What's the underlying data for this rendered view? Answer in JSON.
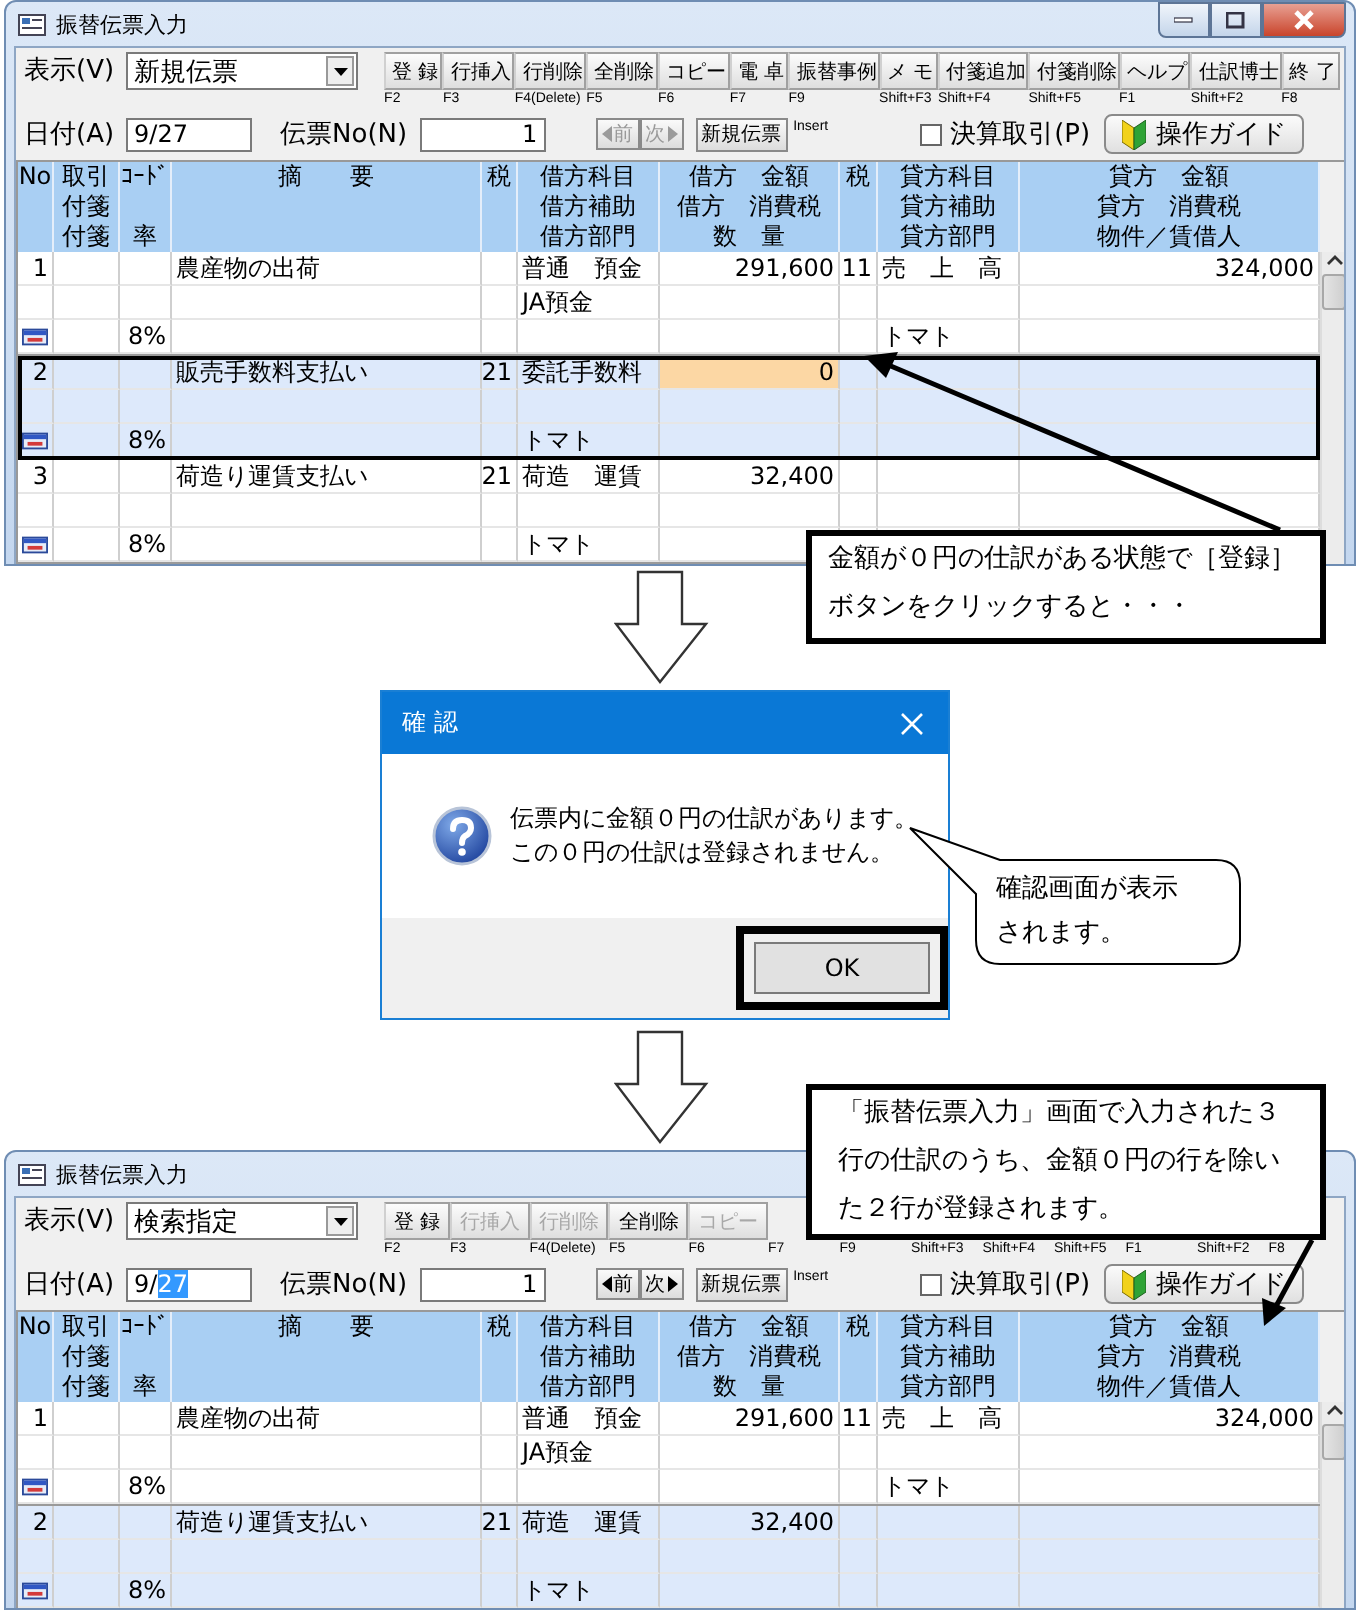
{
  "windows": [
    {
      "title": "振替伝票入力",
      "window_buttons": true,
      "display_label": "表示(V)",
      "display_value": "新規伝票",
      "toolbar": [
        {
          "label": "登 録",
          "key": "F2",
          "disabled": false
        },
        {
          "label": "行挿入",
          "key": "F3",
          "disabled": false
        },
        {
          "label": "行削除",
          "key": "F4(Delete)",
          "disabled": false
        },
        {
          "label": "全削除",
          "key": "F5",
          "disabled": false
        },
        {
          "label": "コピー",
          "key": "F6",
          "disabled": false
        },
        {
          "label": "電 卓",
          "key": "F7",
          "disabled": false
        },
        {
          "label": "振替事例",
          "key": "F9",
          "disabled": false
        },
        {
          "label": "メ モ",
          "key": "Shift+F3",
          "disabled": false
        },
        {
          "label": "付箋追加",
          "key": "Shift+F4",
          "disabled": false
        },
        {
          "label": "付箋削除",
          "key": "Shift+F5",
          "disabled": false
        },
        {
          "label": "ヘルプ",
          "key": "F1",
          "disabled": false
        },
        {
          "label": "仕訳博士",
          "key": "Shift+F2",
          "disabled": false
        },
        {
          "label": "終 了",
          "key": "F8",
          "disabled": false
        }
      ],
      "date_label": "日付(A)",
      "date_parts": [
        {
          "text": "9/27",
          "selected": false
        }
      ],
      "voucher_label": "伝票No(N)",
      "voucher_value": "1",
      "nav": {
        "prev": "前",
        "next": "次",
        "disabled": true
      },
      "new_voucher": "新規伝票",
      "new_voucher_key": "Insert",
      "closing": {
        "label": "決算取引(P)",
        "checked": false
      },
      "guide": "操作ガイド",
      "columns": [
        {
          "top": "No"
        },
        {
          "top": "取引",
          "middle": "付箋",
          "bottom": "付箋"
        },
        {
          "top": "ｺｰﾄﾞ",
          "bottom": "率"
        },
        {
          "top": "摘　　要"
        },
        {
          "top": "税"
        },
        {
          "top": "借方科目",
          "middle": "借方補助",
          "bottom": "借方部門"
        },
        {
          "top": "借方　金額",
          "middle": "借方　消費税",
          "bottom": "数　量"
        },
        {
          "top": "税"
        },
        {
          "top": "貸方科目",
          "middle": "貸方補助",
          "bottom": "貸方部門"
        },
        {
          "top": "貸方　金額",
          "middle": "貸方　消費税",
          "bottom": "物件／賃借人"
        }
      ],
      "rows": [
        {
          "no": "1",
          "summary": "農産物の出荷",
          "debit_account": "普通　預金",
          "debit_amount": "291,600",
          "credit_tax_code": "11",
          "credit_account": "売　上　高",
          "credit_amount": "324,000",
          "debit_sub": "JA預金",
          "tagged": true,
          "rate": "8%",
          "credit_dept": "トマト",
          "current": false,
          "outlined": false,
          "amount_focused": false
        },
        {
          "no": "2",
          "summary": "販売手数料支払い",
          "tax_code": "21",
          "debit_account": "委託手数料",
          "debit_amount": "0",
          "tagged": true,
          "rate": "8%",
          "debit_dept": "トマト",
          "current": true,
          "outlined": true,
          "amount_focused": true
        },
        {
          "no": "3",
          "summary": "荷造り運賃支払い",
          "tax_code": "21",
          "debit_account": "荷造　運賃",
          "debit_amount": "32,400",
          "tagged": true,
          "rate": "8%",
          "debit_dept": "トマト",
          "current": false,
          "outlined": false,
          "amount_focused": false
        }
      ]
    },
    {
      "title": "振替伝票入力",
      "window_buttons": false,
      "display_label": "表示(V)",
      "display_value": "検索指定",
      "toolbar": [
        {
          "label": "登 録",
          "key": "F2",
          "disabled": false
        },
        {
          "label": "行挿入",
          "key": "F3",
          "disabled": true
        },
        {
          "label": "行削除",
          "key": "F4(Delete)",
          "disabled": true
        },
        {
          "label": "全削除",
          "key": "F5",
          "disabled": false
        },
        {
          "label": "コピー",
          "key": "F6",
          "disabled": true
        },
        {
          "key": "F7"
        },
        {
          "key": "F9"
        },
        {
          "key": "Shift+F3"
        },
        {
          "key": "Shift+F4"
        },
        {
          "key": "Shift+F5"
        },
        {
          "key": "F1"
        },
        {
          "key": "Shift+F2"
        },
        {
          "key": "F8"
        }
      ],
      "date_label": "日付(A)",
      "date_parts": [
        {
          "text": "9/",
          "selected": false
        },
        {
          "text": "27",
          "selected": true
        }
      ],
      "voucher_label": "伝票No(N)",
      "voucher_value": "1",
      "nav": {
        "prev": "前",
        "next": "次",
        "disabled": false
      },
      "new_voucher": "新規伝票",
      "new_voucher_key": "Insert",
      "closing": {
        "label": "決算取引(P)",
        "checked": false
      },
      "guide": "操作ガイド",
      "columns": [
        {
          "top": "No"
        },
        {
          "top": "取引",
          "middle": "付箋",
          "bottom": "付箋"
        },
        {
          "top": "ｺｰﾄﾞ",
          "bottom": "率"
        },
        {
          "top": "摘　　要"
        },
        {
          "top": "税"
        },
        {
          "top": "借方科目",
          "middle": "借方補助",
          "bottom": "借方部門"
        },
        {
          "top": "借方　金額",
          "middle": "借方　消費税",
          "bottom": "数　量"
        },
        {
          "top": "税"
        },
        {
          "top": "貸方科目",
          "middle": "貸方補助",
          "bottom": "貸方部門"
        },
        {
          "top": "貸方　金額",
          "middle": "貸方　消費税",
          "bottom": "物件／賃借人"
        }
      ],
      "rows": [
        {
          "no": "1",
          "summary": "農産物の出荷",
          "debit_account": "普通　預金",
          "debit_amount": "291,600",
          "credit_tax_code": "11",
          "credit_account": "売　上　高",
          "credit_amount": "324,000",
          "debit_sub": "JA預金",
          "tagged": true,
          "rate": "8%",
          "credit_dept": "トマト",
          "current": false,
          "outlined": false,
          "amount_focused": false
        },
        {
          "no": "2",
          "summary": "荷造り運賃支払い",
          "tax_code": "21",
          "debit_account": "荷造　運賃",
          "debit_amount": "32,400",
          "tagged": true,
          "rate": "8%",
          "debit_dept": "トマト",
          "current": true,
          "outlined": false,
          "amount_focused": false
        }
      ]
    }
  ],
  "dialog": {
    "title": "確 認",
    "message": "伝票内に金額０円の仕訳があります。この０円の仕訳は登録されません。",
    "ok": "OK",
    "ok_outlined": true
  },
  "callouts": [
    {
      "kind": "box",
      "text": "金額が０円の仕訳がある状態で［登録］ボタンをクリックすると・・・"
    },
    {
      "kind": "bubble",
      "text": "確認画面が表示されます。"
    },
    {
      "kind": "box",
      "text": "「振替伝票入力」画面で入力された３行の仕訳のうち、金額０円の行を除いた２行が登録されます。"
    }
  ]
}
